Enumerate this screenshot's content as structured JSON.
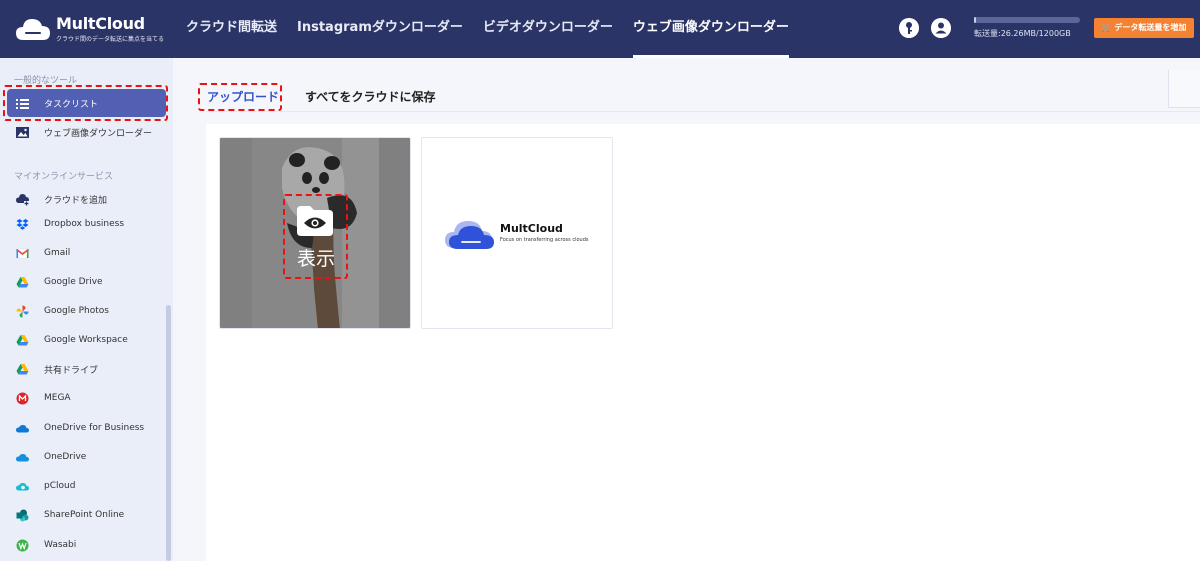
{
  "header": {
    "brand": "MultCloud",
    "tagline": "クラウド間のデータ転送に集点を当てる",
    "nav": [
      {
        "label": "クラウド間転送",
        "active": false
      },
      {
        "label": "Instagramダウンローダー",
        "active": false
      },
      {
        "label": "ビデオダウンローダー",
        "active": false
      },
      {
        "label": "ウェブ画像ダウンローダー",
        "active": true
      }
    ],
    "quota_text": "転送量:26.26MB/1200GB",
    "quota_fraction": 2.19e-05,
    "increase_button": "データ転送量を増加"
  },
  "sidebar": {
    "section_tools": "一般的なツール",
    "tools": [
      {
        "label": "タスクリスト",
        "icon": "list-icon",
        "active": true
      },
      {
        "label": "ウェブ画像ダウンローダー",
        "icon": "image-icon",
        "active": false
      }
    ],
    "section_services": "マイオンラインサービス",
    "services": [
      {
        "label": "クラウドを追加",
        "icon": "add-cloud-icon"
      },
      {
        "label": "Dropbox business",
        "icon": "dropbox-icon"
      },
      {
        "label": "Gmail",
        "icon": "gmail-icon"
      },
      {
        "label": "Google Drive",
        "icon": "google-drive-icon"
      },
      {
        "label": "Google Photos",
        "icon": "google-photos-icon"
      },
      {
        "label": "Google Workspace",
        "icon": "google-workspace-icon"
      },
      {
        "label": "共有ドライブ",
        "icon": "shared-drive-icon"
      },
      {
        "label": "MEGA",
        "icon": "mega-icon"
      },
      {
        "label": "OneDrive for Business",
        "icon": "onedrive-business-icon"
      },
      {
        "label": "OneDrive",
        "icon": "onedrive-icon"
      },
      {
        "label": "pCloud",
        "icon": "pcloud-icon"
      },
      {
        "label": "SharePoint Online",
        "icon": "sharepoint-icon"
      },
      {
        "label": "Wasabi",
        "icon": "wasabi-icon"
      }
    ]
  },
  "main": {
    "tab_upload": "アップロード",
    "tab_save_all": "すべてをクラウドに保存",
    "view_label": "表示",
    "card2_brand": "MultCloud",
    "card2_tagline": "Focus on transferring across clouds"
  },
  "colors": {
    "header_bg": "#2b3467",
    "accent": "#5260b3",
    "orange": "#f58232",
    "highlight": "#ee1111"
  }
}
